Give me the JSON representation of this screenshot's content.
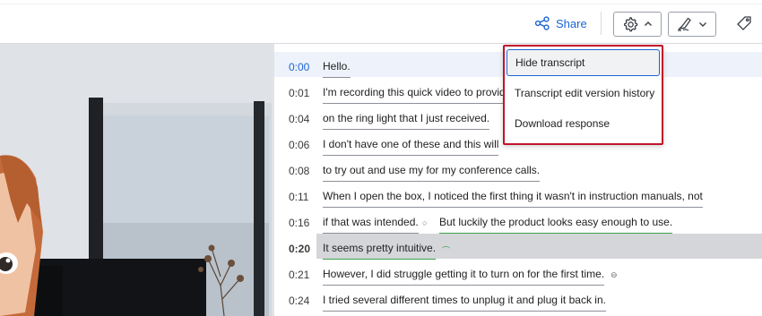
{
  "toolbar": {
    "share_label": "Share",
    "share_icon": "share-nodes-icon",
    "settings_icon": "gear-icon",
    "settings_chevron": "chevron-up-icon",
    "highlight_icon": "highlighter-icon",
    "highlight_chevron": "chevron-down-icon",
    "tag_icon": "tag-icon",
    "accent_color": "#1a64d6"
  },
  "settings_menu": {
    "items": [
      {
        "label": "Hide transcript"
      },
      {
        "label": "Transcript edit version history"
      },
      {
        "label": "Download response"
      }
    ],
    "border_color": "#c0142b"
  },
  "transcript": {
    "lines": [
      {
        "time": "0:00",
        "segments": [
          "Hello."
        ]
      },
      {
        "time": "0:01",
        "segments": [
          "I'm recording this quick video to provid"
        ]
      },
      {
        "time": "0:04",
        "segments": [
          "on the ring light that I just received."
        ]
      },
      {
        "time": "0:06",
        "segments": [
          "I don't have one of these and this will"
        ]
      },
      {
        "time": "0:08",
        "segments": [
          "to try out and use my for my conference calls."
        ]
      },
      {
        "time": "0:11",
        "segments": [
          "When I open the box, I noticed the first thing it wasn't in instruction manuals, not"
        ]
      },
      {
        "time": "0:16",
        "segments": [
          "if that was intended.",
          "But luckily the product looks easy enough to use."
        ]
      },
      {
        "time": "0:20",
        "segments": [
          "It seems pretty intuitive."
        ]
      },
      {
        "time": "0:21",
        "segments": [
          "However, I did struggle getting it to turn on for the first time."
        ]
      },
      {
        "time": "0:24",
        "segments": [
          "I tried several different times to unplug it and plug it back in."
        ]
      }
    ],
    "highlight_color": "#3aa34a"
  }
}
